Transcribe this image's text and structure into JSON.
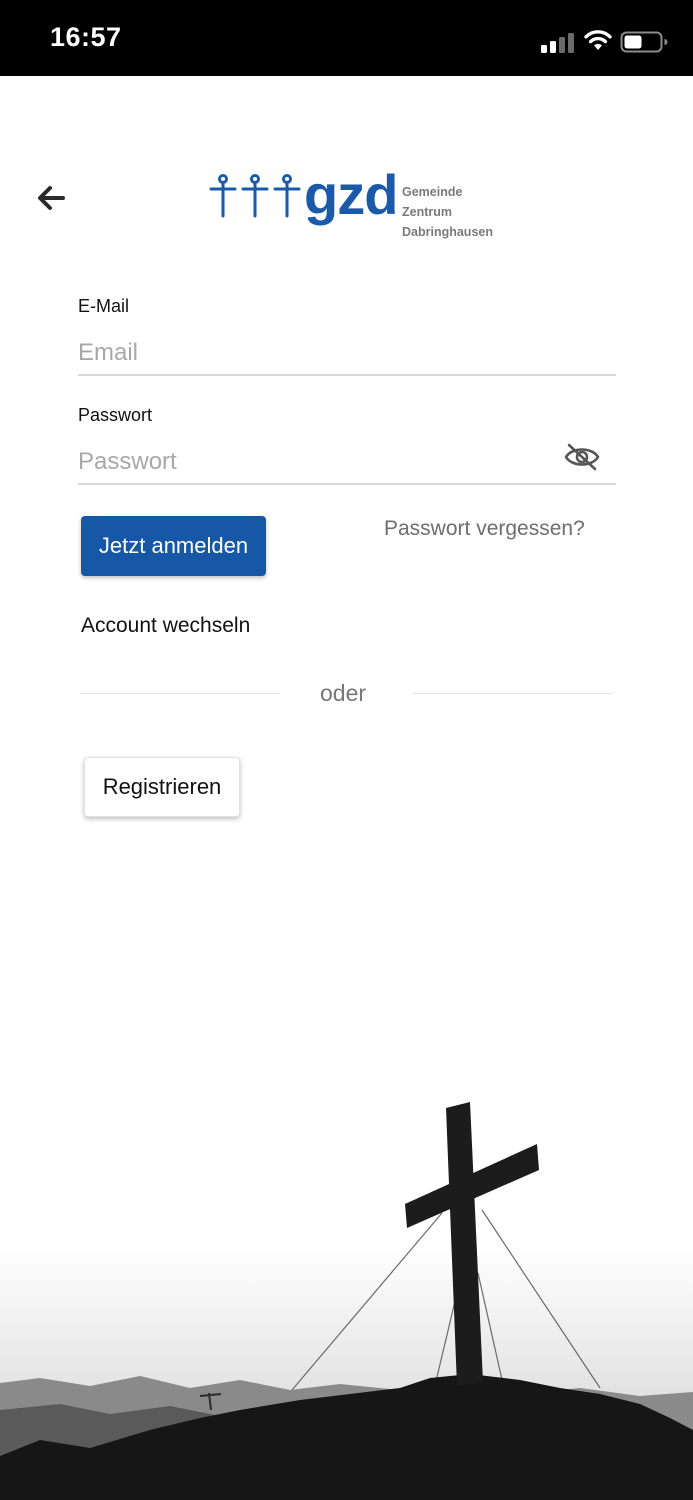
{
  "status_bar": {
    "time": "16:57",
    "icons": [
      "cellular-signal-icon",
      "wifi-icon",
      "battery-icon"
    ]
  },
  "header": {
    "back_icon": "arrow-left-icon",
    "logo": {
      "wordmark": "gzd",
      "subtitle_lines": [
        "Gemeinde",
        "Zentrum",
        "Dabringhausen"
      ],
      "color": "#1b5aa8"
    }
  },
  "form": {
    "email": {
      "label": "E-Mail",
      "placeholder": "Email",
      "value": ""
    },
    "password": {
      "label": "Passwort",
      "placeholder": "Passwort",
      "value": "",
      "toggle_icon": "eye-slash-icon"
    },
    "login_button": "Jetzt anmelden",
    "forgot_link": "Passwort vergessen?",
    "switch_account": "Account wechseln",
    "divider_text": "oder",
    "register_button": "Registrieren"
  },
  "colors": {
    "primary": "#1657a6",
    "muted_text": "#6e6e6e",
    "placeholder": "#a8a8a8"
  },
  "background_image": "summit-cross-silhouette"
}
